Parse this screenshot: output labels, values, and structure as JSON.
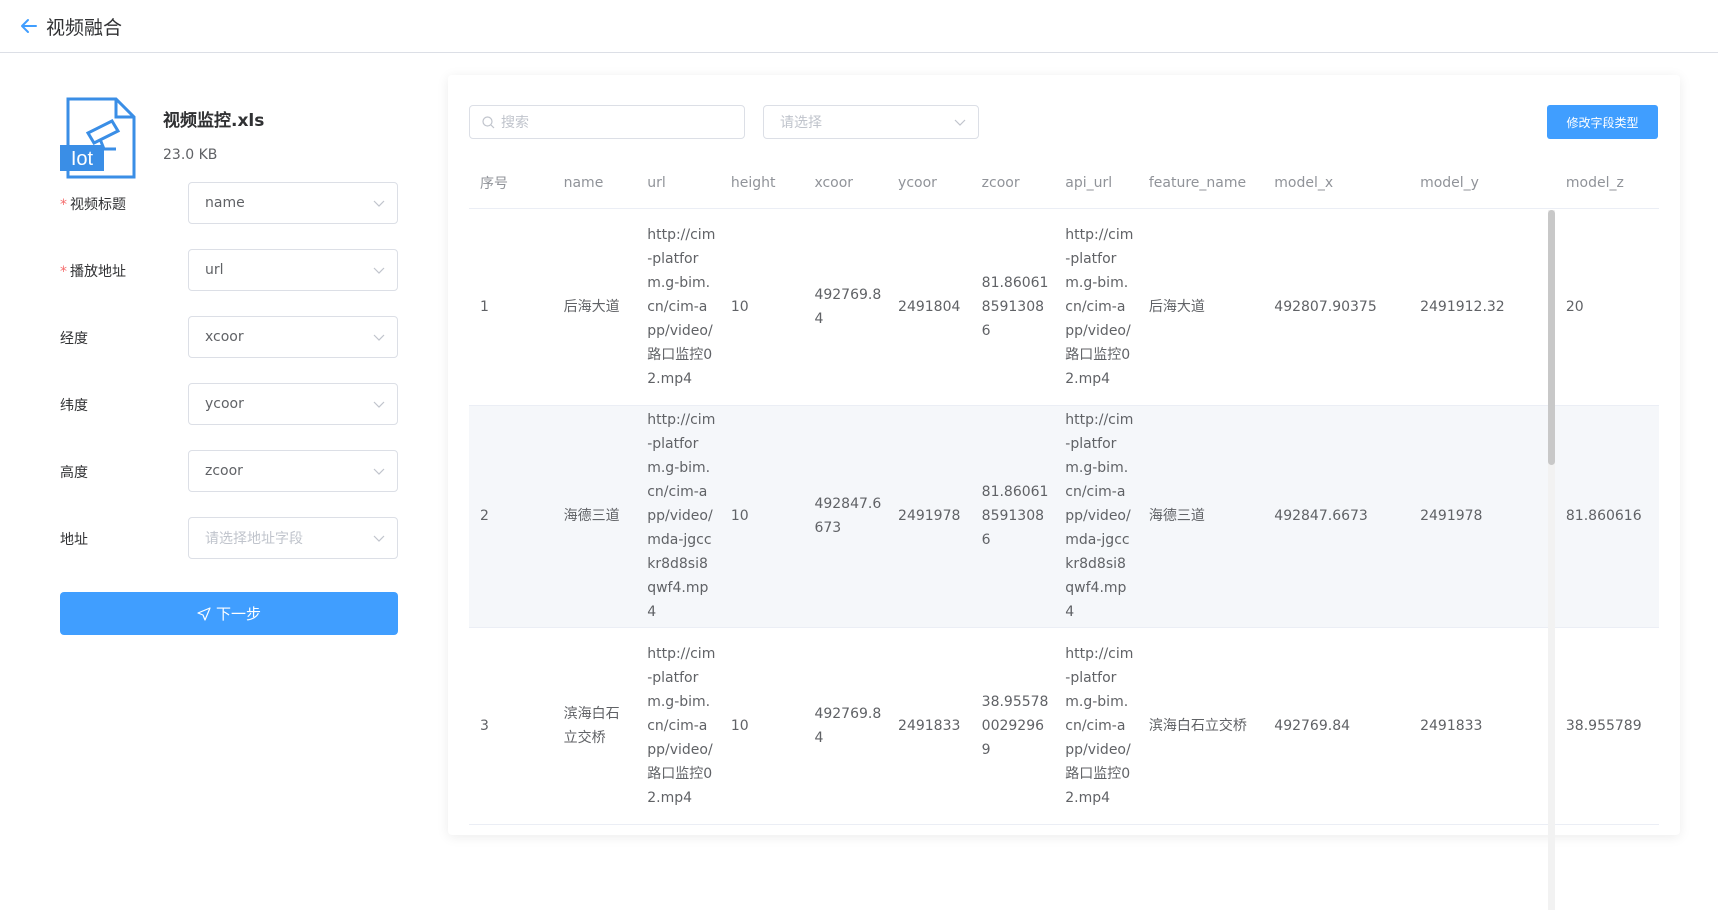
{
  "header": {
    "title": "视频融合"
  },
  "file": {
    "name": "视频监控.xls",
    "size": "23.0 KB",
    "icon_text": "Iot"
  },
  "form": {
    "fields": [
      {
        "label": "视频标题",
        "required": true,
        "value": "name"
      },
      {
        "label": "播放地址",
        "required": true,
        "value": "url"
      },
      {
        "label": "经度",
        "required": false,
        "value": "xcoor"
      },
      {
        "label": "纬度",
        "required": false,
        "value": "ycoor"
      },
      {
        "label": "高度",
        "required": false,
        "value": "zcoor"
      },
      {
        "label": "地址",
        "required": false,
        "placeholder": "请选择地址字段"
      }
    ],
    "next_label": "下一步"
  },
  "toolbar": {
    "search_placeholder": "搜索",
    "filter_placeholder": "请选择",
    "edit_label": "修改字段类型"
  },
  "table": {
    "headers": [
      "序号",
      "name",
      "url",
      "height",
      "xcoor",
      "ycoor",
      "zcoor",
      "api_url",
      "feature_name",
      "model_x",
      "model_y",
      "model_z"
    ],
    "rows": [
      [
        "1",
        "后海大道",
        "http://cim-platform.g-bim.cn/cim-app/video/路口监控02.mp4",
        "10",
        "492769.84",
        "2491804",
        "81.860618591308 6",
        "http://cim-platform.g-bim.cn/cim-app/video/路口监控02.mp4",
        "后海大道",
        "492807.90375",
        "2491912.32",
        "20"
      ],
      [
        "2",
        "海德三道",
        "http://cim-platform.g-bim.cn/cim-app/video/mda-jgcckr8d8si8qwf4.mp4",
        "10",
        "492847.6673",
        "2491978",
        "81.860618591308 6",
        "http://cim-platform.g-bim.cn/cim-app/video/mda-jgcckr8d8si8qwf4.mp4",
        "海德三道",
        "492847.6673",
        "2491978",
        "81.860616"
      ],
      [
        "3",
        "滨海白石立交桥",
        "http://cim-platform.g-bim.cn/cim-app/video/路口监控02.mp4",
        "10",
        "492769.84",
        "2491833",
        "38.955780029296 9",
        "http://cim-platform.g-bim.cn/cim-app/video/路口监控02.mp4",
        "滨海白石立交桥",
        "492769.84",
        "2491833",
        "38.955789"
      ]
    ]
  },
  "colors": {
    "primary": "#409eff",
    "required": "#f56c6c"
  }
}
